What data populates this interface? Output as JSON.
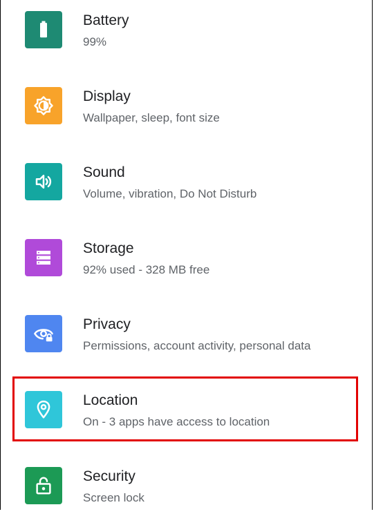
{
  "settings": {
    "items": [
      {
        "title": "Battery",
        "subtitle": "99%",
        "icon": "battery-icon",
        "color": "#1e8a73"
      },
      {
        "title": "Display",
        "subtitle": "Wallpaper, sleep, font size",
        "icon": "brightness-icon",
        "color": "#f8a32a"
      },
      {
        "title": "Sound",
        "subtitle": "Volume, vibration, Do Not Disturb",
        "icon": "volume-icon",
        "color": "#14a7a0"
      },
      {
        "title": "Storage",
        "subtitle": "92% used - 328 MB free",
        "icon": "storage-icon",
        "color": "#b04ad9"
      },
      {
        "title": "Privacy",
        "subtitle": "Permissions, account activity, personal data",
        "icon": "privacy-eye-icon",
        "color": "#4f86f0"
      },
      {
        "title": "Location",
        "subtitle": "On - 3 apps have access to location",
        "icon": "location-pin-icon",
        "color": "#2fc6d9"
      },
      {
        "title": "Security",
        "subtitle": "Screen lock",
        "icon": "lock-open-icon",
        "color": "#1c9a55"
      }
    ]
  },
  "highlight": {
    "color": "#e20000",
    "target": "Location"
  }
}
